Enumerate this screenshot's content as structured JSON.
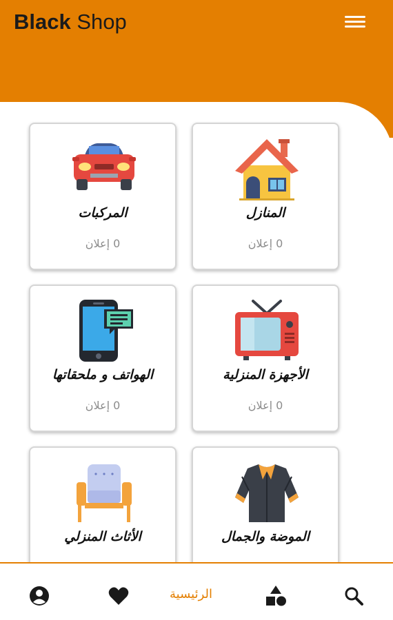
{
  "header": {
    "brand_bold": "Black",
    "brand_light": "Shop",
    "accent_color": "#E47F01"
  },
  "categories": [
    {
      "name": "المنازل",
      "count": "0 إعلان",
      "icon": "house-icon"
    },
    {
      "name": "المركبات",
      "count": "0 إعلان",
      "icon": "car-icon"
    },
    {
      "name": "الأجهزة المنزلية",
      "count": "0 إعلان",
      "icon": "tv-icon"
    },
    {
      "name": "الهواتف و ملحقاتها",
      "count": "0 إعلان",
      "icon": "phone-icon"
    },
    {
      "name": "الموضة والجمال",
      "count": "",
      "icon": "jacket-icon"
    },
    {
      "name": "الأثاث المنزلي",
      "count": "",
      "icon": "armchair-icon"
    }
  ],
  "bottom_nav": {
    "items": [
      {
        "icon": "profile-icon"
      },
      {
        "icon": "heart-icon"
      },
      {
        "icon": "home",
        "label": "الرئيسية",
        "active": true
      },
      {
        "icon": "categories-icon"
      },
      {
        "icon": "search-icon"
      }
    ]
  }
}
